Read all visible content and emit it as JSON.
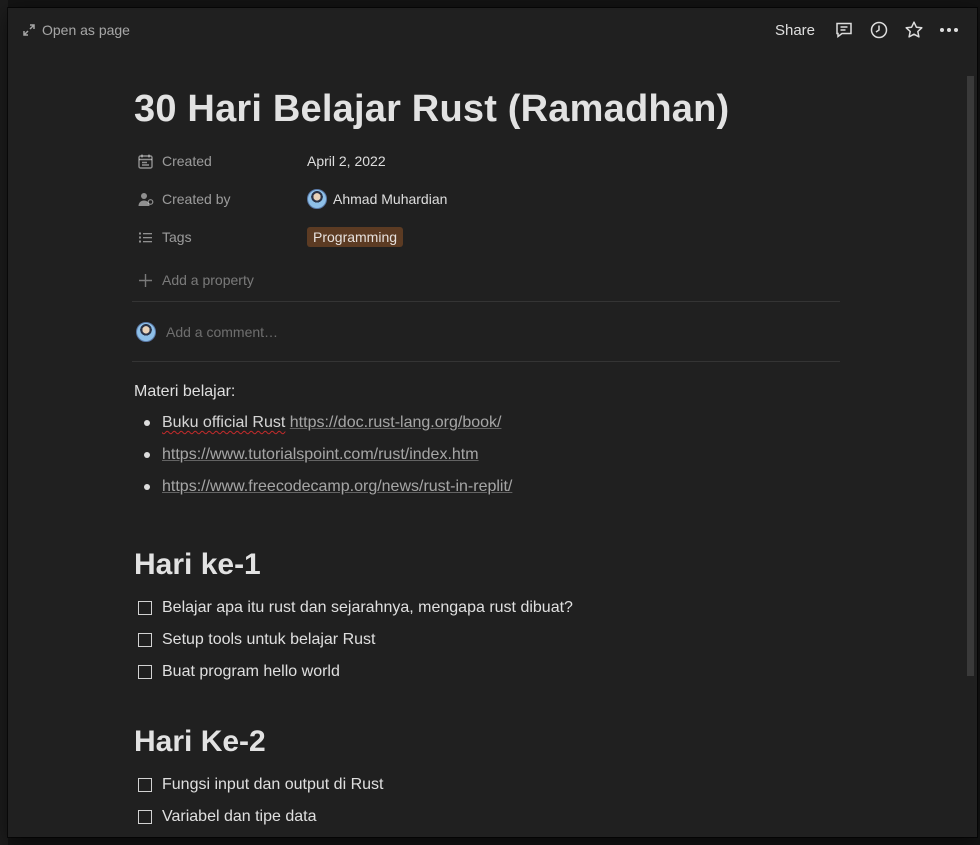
{
  "topbar": {
    "open_as_page": "Open as page",
    "share": "Share",
    "icons": [
      "comment-icon",
      "history-icon",
      "star-icon",
      "more-icon"
    ]
  },
  "page": {
    "title": "30 Hari Belajar Rust (Ramadhan)",
    "properties": {
      "created": {
        "name": "Created",
        "value": "April 2, 2022",
        "icon": "calendar-icon"
      },
      "created_by": {
        "name": "Created by",
        "value": "Ahmad Muhardian",
        "icon": "person-icon"
      },
      "tags": {
        "name": "Tags",
        "value": "Programming",
        "icon": "list-icon",
        "tag_color": "#5c3b23"
      },
      "add": "Add a property"
    },
    "comment_placeholder": "Add a comment…",
    "intro": "Materi belajar:",
    "bullets": {
      "b1_text": "Buku official Rust",
      "b1_link": "https://doc.rust-lang.org/book/",
      "b2_link": "https://www.tutorialspoint.com/rust/index.htm",
      "b3_link": "https://www.freecodecamp.org/news/rust-in-replit/"
    },
    "sections": [
      {
        "heading": "Hari ke-1",
        "todos": [
          "Belajar apa itu rust dan sejarahnya, mengapa rust dibuat?",
          "Setup tools untuk belajar Rust",
          "Buat program hello world"
        ]
      },
      {
        "heading": "Hari Ke-2",
        "todos": [
          "Fungsi input dan output di Rust",
          "Variabel dan tipe data"
        ]
      }
    ]
  }
}
